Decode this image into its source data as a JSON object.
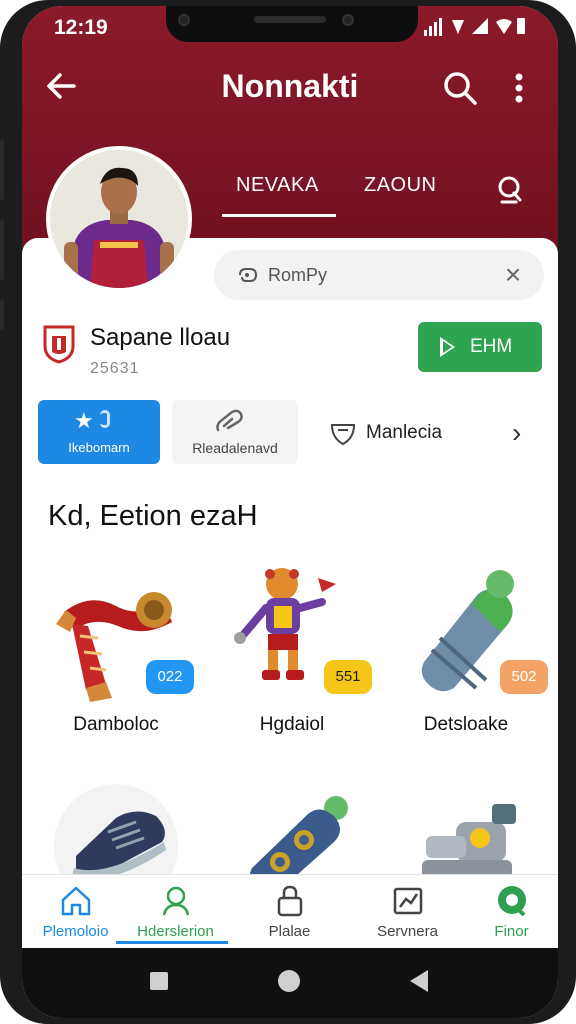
{
  "status_bar": {
    "time": "12:19",
    "icons": "📶▾ ◢ ▮"
  },
  "app_bar": {
    "title": "Nonnakti",
    "back_icon": "arrow-left-icon",
    "search_icon": "search-icon",
    "more_icon": "more-vert-icon"
  },
  "profile_tabs": [
    {
      "label": "NEVAKA",
      "active": true
    },
    {
      "label": "ZAOUN",
      "active": false
    }
  ],
  "search": {
    "placeholder": "RomPy",
    "close_label": "×"
  },
  "team": {
    "name": "Sapane lloau",
    "sub": "25631",
    "action_label": "EHM"
  },
  "chips": [
    {
      "label": "Ikebomarn",
      "icon": "star-icon",
      "active": true
    },
    {
      "label": "Rleadalenavd",
      "icon": "link-icon",
      "active": false
    },
    {
      "label": "Manlecia",
      "icon": "shield-icon",
      "active": false
    }
  ],
  "section": {
    "title": "Kd, Eetion ezaH"
  },
  "items": [
    {
      "name": "Damboloc",
      "badge": "022",
      "badge_color": "#2196f3",
      "icon": "scarf-icon"
    },
    {
      "name": "Hgdaiol",
      "badge": "551",
      "badge_color": "#f5c518",
      "icon": "mascot-icon"
    },
    {
      "name": "Detsloake",
      "badge": "502",
      "badge_color": "#f2a365",
      "icon": "canister-icon"
    },
    {
      "name": "",
      "badge": "",
      "badge_color": "#f5c518",
      "icon": "shoe-icon"
    },
    {
      "name": "",
      "badge": "",
      "badge_color": "#f5c518",
      "icon": "cylinder-icon"
    },
    {
      "name": "",
      "badge": "",
      "badge_color": "#f5c518",
      "icon": "robot-part-icon"
    }
  ],
  "bottom_nav": [
    {
      "label": "Plemoloio",
      "icon": "home-icon",
      "color": "#1e88e5"
    },
    {
      "label": "Hderslerion",
      "icon": "person-icon",
      "color": "#2e9e4f"
    },
    {
      "label": "Plalae",
      "icon": "lock-icon",
      "color": "#444444"
    },
    {
      "label": "Servnera",
      "icon": "chart-icon",
      "color": "#444444"
    },
    {
      "label": "Finor",
      "icon": "chat-icon",
      "color": "#2e9e4f"
    }
  ],
  "colors": {
    "header": "#7d1526",
    "accent_blue": "#1e88e5",
    "accent_green": "#2ea44f"
  }
}
